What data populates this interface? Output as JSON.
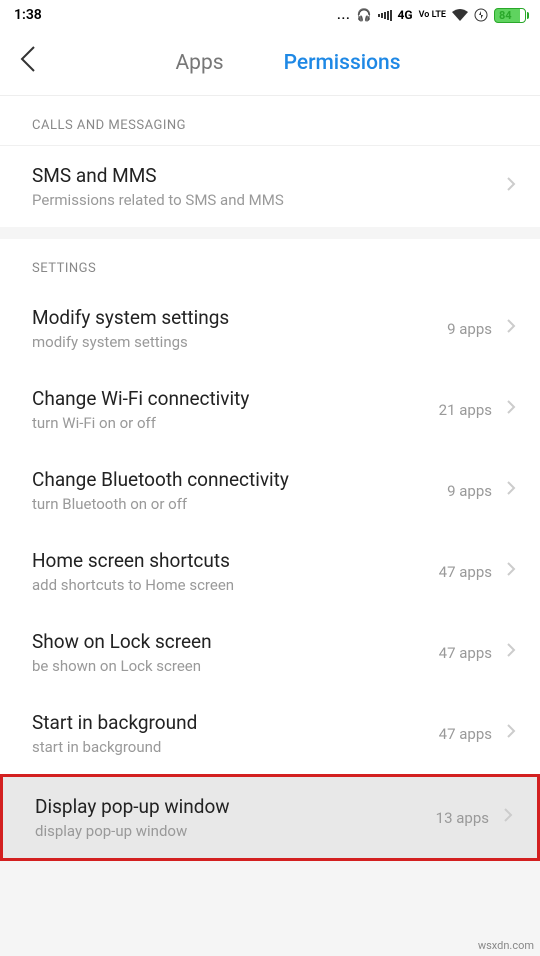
{
  "status": {
    "time": "1:38",
    "network_label": "4G",
    "volte": "Vo LTE",
    "battery": "84"
  },
  "header": {
    "tabs": {
      "apps": "Apps",
      "permissions": "Permissions"
    }
  },
  "sections": {
    "calls": {
      "header": "CALLS AND MESSAGING",
      "sms": {
        "title": "SMS and MMS",
        "subtitle": "Permissions related to SMS and MMS"
      }
    },
    "settings": {
      "header": "SETTINGS",
      "items": [
        {
          "title": "Modify system settings",
          "subtitle": "modify system settings",
          "value": "9 apps"
        },
        {
          "title": "Change Wi-Fi connectivity",
          "subtitle": "turn Wi-Fi on or off",
          "value": "21 apps"
        },
        {
          "title": "Change Bluetooth connectivity",
          "subtitle": "turn Bluetooth on or off",
          "value": "9 apps"
        },
        {
          "title": "Home screen shortcuts",
          "subtitle": "add shortcuts to Home screen",
          "value": "47 apps"
        },
        {
          "title": "Show on Lock screen",
          "subtitle": "be shown on Lock screen",
          "value": "47 apps"
        },
        {
          "title": "Start in background",
          "subtitle": "start in background",
          "value": "47 apps"
        },
        {
          "title": "Display pop-up window",
          "subtitle": "display pop-up window",
          "value": "13 apps"
        }
      ]
    }
  },
  "watermark": "wsxdn.com"
}
